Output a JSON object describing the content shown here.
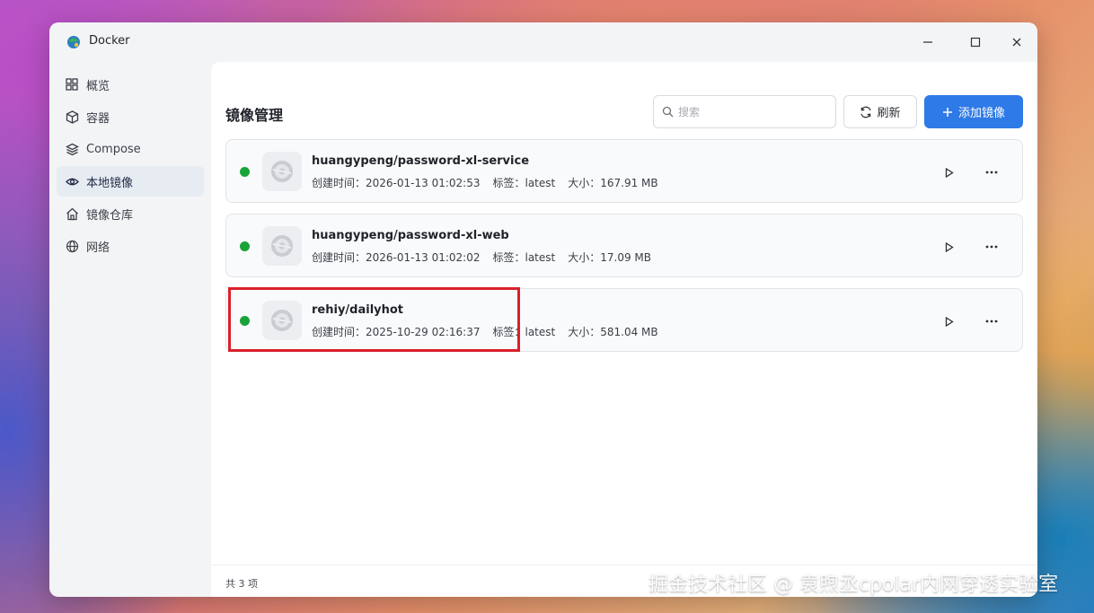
{
  "window": {
    "title": "Docker",
    "controls": {
      "minimize_icon": "minimize-icon",
      "maximize_icon": "maximize-icon",
      "close_icon": "close-icon"
    }
  },
  "sidebar": {
    "items": [
      {
        "label": "概览",
        "icon": "grid-icon",
        "active": false
      },
      {
        "label": "容器",
        "icon": "cube-icon",
        "active": false
      },
      {
        "label": "Compose",
        "icon": "layers-icon",
        "active": false
      },
      {
        "label": "本地镜像",
        "icon": "eye-icon",
        "active": true
      },
      {
        "label": "镜像仓库",
        "icon": "home-icon",
        "active": false
      },
      {
        "label": "网络",
        "icon": "globe-icon",
        "active": false
      }
    ]
  },
  "main": {
    "title": "镜像管理",
    "search_placeholder": "搜索",
    "refresh_label": "刷新",
    "add_label": "添加镜像"
  },
  "images": [
    {
      "name": "huangypeng/password-xl-service",
      "created_label": "创建时间：",
      "created": "2026-01-13 01:02:53",
      "tag_label": "标签：",
      "tag": "latest",
      "size_label": "大小：",
      "size": "167.91 MB",
      "status_color": "#1aa33a"
    },
    {
      "name": "huangypeng/password-xl-web",
      "created_label": "创建时间：",
      "created": "2026-01-13 01:02:02",
      "tag_label": "标签：",
      "tag": "latest",
      "size_label": "大小：",
      "size": "17.09 MB",
      "status_color": "#1aa33a"
    },
    {
      "name": "rehiy/dailyhot",
      "created_label": "创建时间：",
      "created": "2025-10-29 02:16:37",
      "tag_label": "标签：",
      "tag": "latest",
      "size_label": "大小：",
      "size": "581.04 MB",
      "status_color": "#1aa33a"
    }
  ],
  "footer": {
    "count_text": "共 3 项"
  },
  "watermark": "掘金技术社区 @ 袁煦丞cpolar内网穿透实验室",
  "colors": {
    "accent": "#2e7ae6",
    "highlight": "#d9212b",
    "running": "#1aa33a"
  }
}
